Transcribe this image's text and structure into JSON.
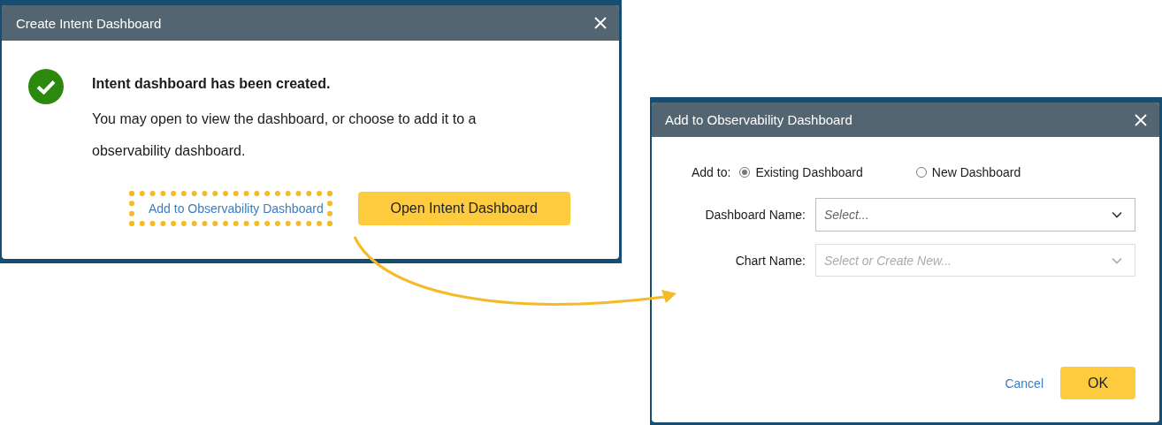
{
  "create_dialog": {
    "title": "Create Intent Dashboard",
    "heading": "Intent dashboard has been created.",
    "message": "You may open to view the dashboard, or choose to add it to a observability dashboard.",
    "link": "Add to Observability Dashboard",
    "link_highlighted": true,
    "button": "Open Intent Dashboard"
  },
  "add_dialog": {
    "title": "Add to Observability Dashboard",
    "add_to_label": "Add to:",
    "radios": [
      {
        "label": "Existing Dashboard",
        "selected": true
      },
      {
        "label": "New Dashboard",
        "selected": false
      }
    ],
    "fields": [
      {
        "label": "Dashboard Name:",
        "placeholder": "Select...",
        "disabled": false
      },
      {
        "label": "Chart Name:",
        "placeholder": "Select or Create New...",
        "disabled": true
      }
    ],
    "cancel": "Cancel",
    "ok": "OK"
  }
}
